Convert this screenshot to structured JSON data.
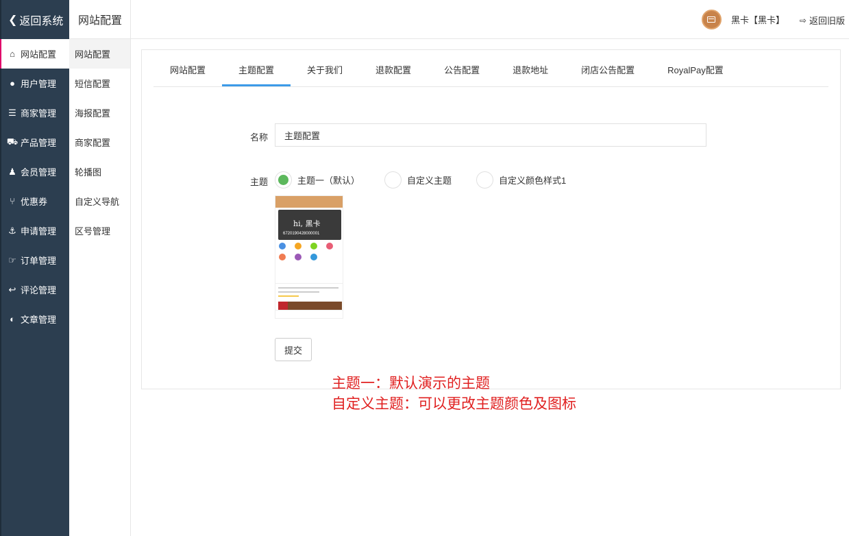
{
  "sidebar": {
    "back_label": "返回系统",
    "items": [
      {
        "label": "网站配置",
        "icon": "home-icon"
      },
      {
        "label": "用户管理",
        "icon": "user-icon"
      },
      {
        "label": "商家管理",
        "icon": "server-icon"
      },
      {
        "label": "产品管理",
        "icon": "cart-icon"
      },
      {
        "label": "会员管理",
        "icon": "users-icon"
      },
      {
        "label": "优惠券",
        "icon": "fork-icon"
      },
      {
        "label": "申请管理",
        "icon": "anchor-icon"
      },
      {
        "label": "订单管理",
        "icon": "hand-icon"
      },
      {
        "label": "评论管理",
        "icon": "reply-icon"
      },
      {
        "label": "文章管理",
        "icon": "contrast-icon"
      }
    ]
  },
  "subnav": {
    "title": "网站配置",
    "items": [
      "网站配置",
      "短信配置",
      "海报配置",
      "商家配置",
      "轮播图",
      "自定义导航",
      "区号管理"
    ]
  },
  "header": {
    "user_name": "黑卡【黑卡】",
    "old_version_label": "返回旧版"
  },
  "tabs": [
    "网站配置",
    "主题配置",
    "关于我们",
    "退款配置",
    "公告配置",
    "退款地址",
    "闭店公告配置",
    "RoyalPay配置"
  ],
  "form": {
    "name_label": "名称",
    "name_value": "主题配置",
    "theme_label": "主题",
    "themes": [
      "主题一（默认）",
      "自定义主题",
      "自定义颜色样式1"
    ],
    "selected_theme": 0,
    "submit_label": "提交"
  },
  "preview": {
    "greeting": "hi, 黑卡",
    "card_number": "6720190428000001"
  },
  "notes": [
    "主题一：默认演示的主题",
    "自定义主题：可以更改主题颜色及图标"
  ],
  "colors": {
    "sidebar_bg": "#2c3e50",
    "tab_active": "#3c9be8",
    "radio_on": "#5cb85c",
    "note_text": "#e02020"
  }
}
